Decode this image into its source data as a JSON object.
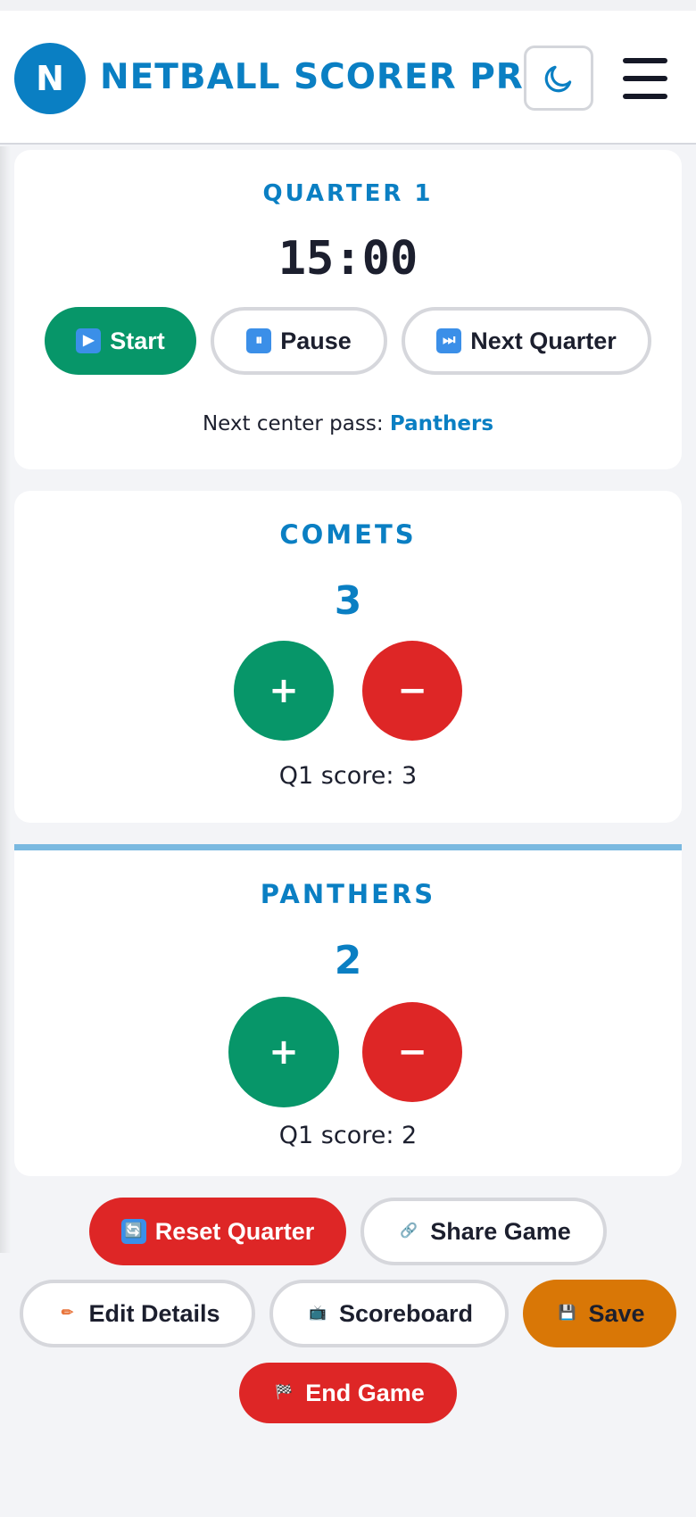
{
  "header": {
    "logo_letter": "N",
    "title": "NETBALL SCORER PRO",
    "theme_icon": "moon-icon",
    "menu_icon": "hamburger-menu-icon"
  },
  "timer": {
    "quarter_label": "QUARTER 1",
    "clock": "15:00",
    "start_label": "Start",
    "pause_label": "Pause",
    "next_quarter_label": "Next Quarter",
    "center_pass_prefix": "Next center pass:",
    "center_pass_team": "Panthers"
  },
  "teams": [
    {
      "name": "COMETS",
      "score": "3",
      "plus": "+",
      "minus": "−",
      "quarter_score": "Q1 score: 3"
    },
    {
      "name": "PANTHERS",
      "score": "2",
      "plus": "+",
      "minus": "−",
      "quarter_score": "Q1 score: 2"
    }
  ],
  "actions": {
    "reset_quarter": "Reset Quarter",
    "share_game": "Share Game",
    "edit_details": "Edit Details",
    "scoreboard": "Scoreboard",
    "save": "Save",
    "end_game": "End Game"
  },
  "icons": {
    "start": "▶",
    "pause": "⏸",
    "next_quarter": "⏭",
    "reset": "🔄",
    "share": "🔗",
    "edit": "✏",
    "scoreboard": "📺",
    "save": "💾",
    "end": "🏁"
  },
  "colors": {
    "brand_blue": "#0a7fc3",
    "green": "#079669",
    "red": "#de2626",
    "orange": "#d97706"
  }
}
